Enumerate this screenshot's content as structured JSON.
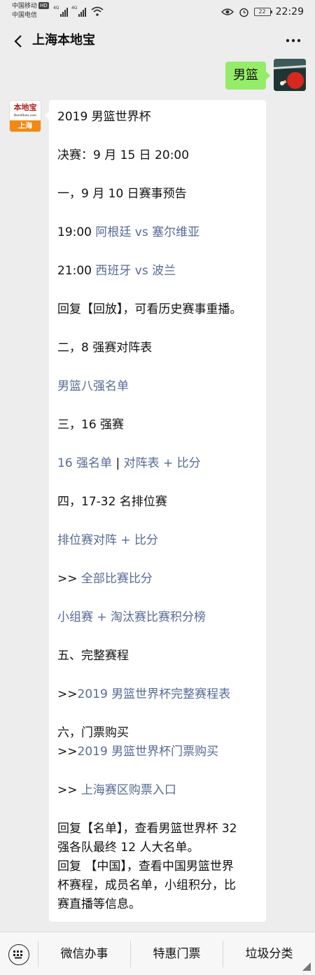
{
  "status_bar": {
    "carrier1": "中国移动",
    "hd": "HD",
    "carrier2": "中国电信",
    "net1": "4G",
    "net2": "4G",
    "battery": "22",
    "time": "22:29"
  },
  "nav": {
    "title": "上海本地宝"
  },
  "sent": {
    "text": "男篮"
  },
  "logo": {
    "top": "本地宝",
    "sub": "Bendibao.com",
    "bottom": "上海"
  },
  "reply": {
    "l1": "2019 男篮世界杯",
    "l2": "决赛：9 月 15 日 20:00",
    "l3": "一，9 月 10 日赛事预告",
    "l4_time": "19:00",
    "l4_link": "阿根廷 vs 塞尔维亚",
    "l5_time": "21:00",
    "l5_link": "西班牙 vs 波兰",
    "l6": "回复【回放】，可看历史赛事重播。",
    "l7": "二，8 强赛对阵表",
    "l8_link": "男篮八强名单",
    "l9": "三，16 强赛",
    "l10_link_a": "16 强名单",
    "l10_sep": "|",
    "l10_link_b": "对阵表 + 比分",
    "l11": "四，17-32 名排位赛",
    "l12_link": "排位赛对阵 + 比分",
    "l13_prefix": ">>",
    "l13_link": "全部比赛比分",
    "l14_link": "小组赛 + 淘汰赛比赛积分榜",
    "l15": "五、完整赛程",
    "l16_prefix": ">>",
    "l16_link": "2019 男篮世界杯完整赛程表",
    "l17": "六，门票购买",
    "l18_prefix": ">>",
    "l18_link": "2019 男篮世界杯门票购买",
    "l19_prefix": ">>",
    "l19_link": "上海赛区购票入口",
    "l20": "回复【名单】，查看男篮世界杯 32",
    "l21": "强各队最终 12 人大名单。",
    "l22": "回复 【中国】，查看中国男篮世界",
    "l23": "杯赛程，成员名单，小组积分，比",
    "l24": "赛直播等信息。"
  },
  "bottom_menu": {
    "item1": "微信办事",
    "item2": "特惠门票",
    "item3": "垃圾分类"
  },
  "colors": {
    "background": "#ededed",
    "sent_bubble": "#95ec69",
    "link": "#576b95",
    "logo_orange": "#f08a12",
    "logo_red": "#b3211e"
  },
  "icons": [
    "back-icon",
    "more-icon",
    "eye-icon",
    "alarm-icon",
    "wifi-icon",
    "keyboard-icon"
  ]
}
